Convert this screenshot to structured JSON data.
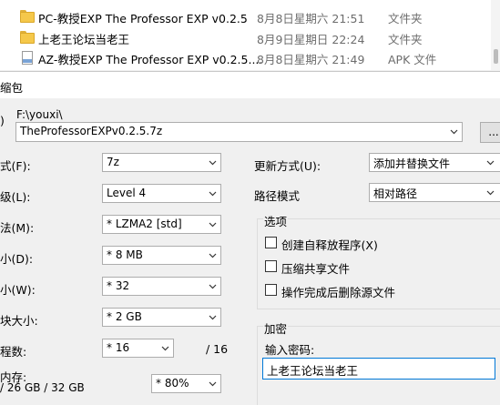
{
  "files": [
    {
      "name": "PC-教授EXP The Professor EXP v0.2.5",
      "date": "8月8日星期六 21:51",
      "type": "文件夹",
      "icon": "folder-icon"
    },
    {
      "name": "上老王论坛当老王",
      "date": "8月9日星期日 22:24",
      "type": "文件夹",
      "icon": "folder-icon"
    },
    {
      "name": "AZ-教授EXP The Professor EXP v0.2.5....",
      "date": "8月8日星期六 21:49",
      "type": "APK 文件",
      "icon": "apk-file-icon"
    }
  ],
  "dialog": {
    "title": "缩包",
    "archive_label": ")",
    "path": "F:\\youxi\\",
    "archive_name": "TheProfessorEXPv0.2.5.7z",
    "browse_label": "...",
    "left_labels": {
      "format": "式(F):",
      "level": "级(L):",
      "method": "法(M):",
      "dict": "小(D):",
      "word": "小(W):",
      "solid": "块大小:",
      "threads": "程数:",
      "memory": "内存:",
      "memory_info": "/ 26 GB / 32 GB"
    },
    "format_value": "7z",
    "level_value": "Level 4",
    "method_value": "* LZMA2 [std]",
    "dict_value": "* 8 MB",
    "word_value": "* 32",
    "solid_value": "* 2 GB",
    "threads_value": "* 16",
    "threads_max": "/ 16",
    "memory_value": "* 80%",
    "update_label": "更新方式(U):",
    "update_value": "添加并替换文件",
    "path_mode_label": "路径模式",
    "path_mode_value": "相对路径",
    "options_title": "选项",
    "options": [
      "创建自释放程序(X)",
      "压缩共享文件",
      "操作完成后删除源文件"
    ],
    "encryption_title": "加密",
    "password_label": "输入密码:",
    "password_value": "上老王论坛当老王"
  },
  "colors": {
    "folder": "#f5c84a",
    "dialog_bg": "#f0f0f0",
    "focus_border": "#0078d7",
    "secondary_text": "#6d6d6d"
  }
}
